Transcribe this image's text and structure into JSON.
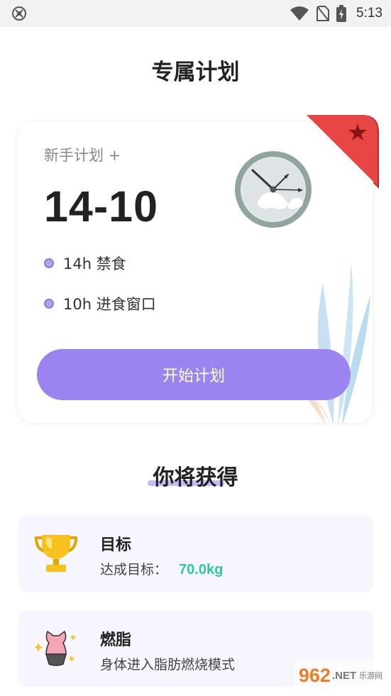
{
  "status_bar": {
    "time": "5:13",
    "icons": [
      "app-notification-icon",
      "wifi-icon",
      "no-sim-icon",
      "battery-charging-icon"
    ]
  },
  "page": {
    "title": "专属计划"
  },
  "plan_card": {
    "subtitle": "新手计划 +",
    "ratio": "14-10",
    "bullets": [
      {
        "label": "14h 禁食"
      },
      {
        "label": "10h 进食窗口"
      }
    ],
    "start_button": "开始计划",
    "ribbon_icon": "star-icon",
    "colors": {
      "accent": "#9b84f0",
      "ribbon": "#e84545"
    }
  },
  "gains": {
    "title": "你将获得",
    "items": [
      {
        "icon": "trophy-icon",
        "title": "目标",
        "desc": "达成目标：",
        "value": "70.0kg"
      },
      {
        "icon": "body-shape-icon",
        "title": "燃脂",
        "desc": "身体进入脂肪燃烧模式"
      }
    ]
  },
  "watermark": {
    "text": "962",
    "suffix": ".NET",
    "sub": "乐游网"
  }
}
